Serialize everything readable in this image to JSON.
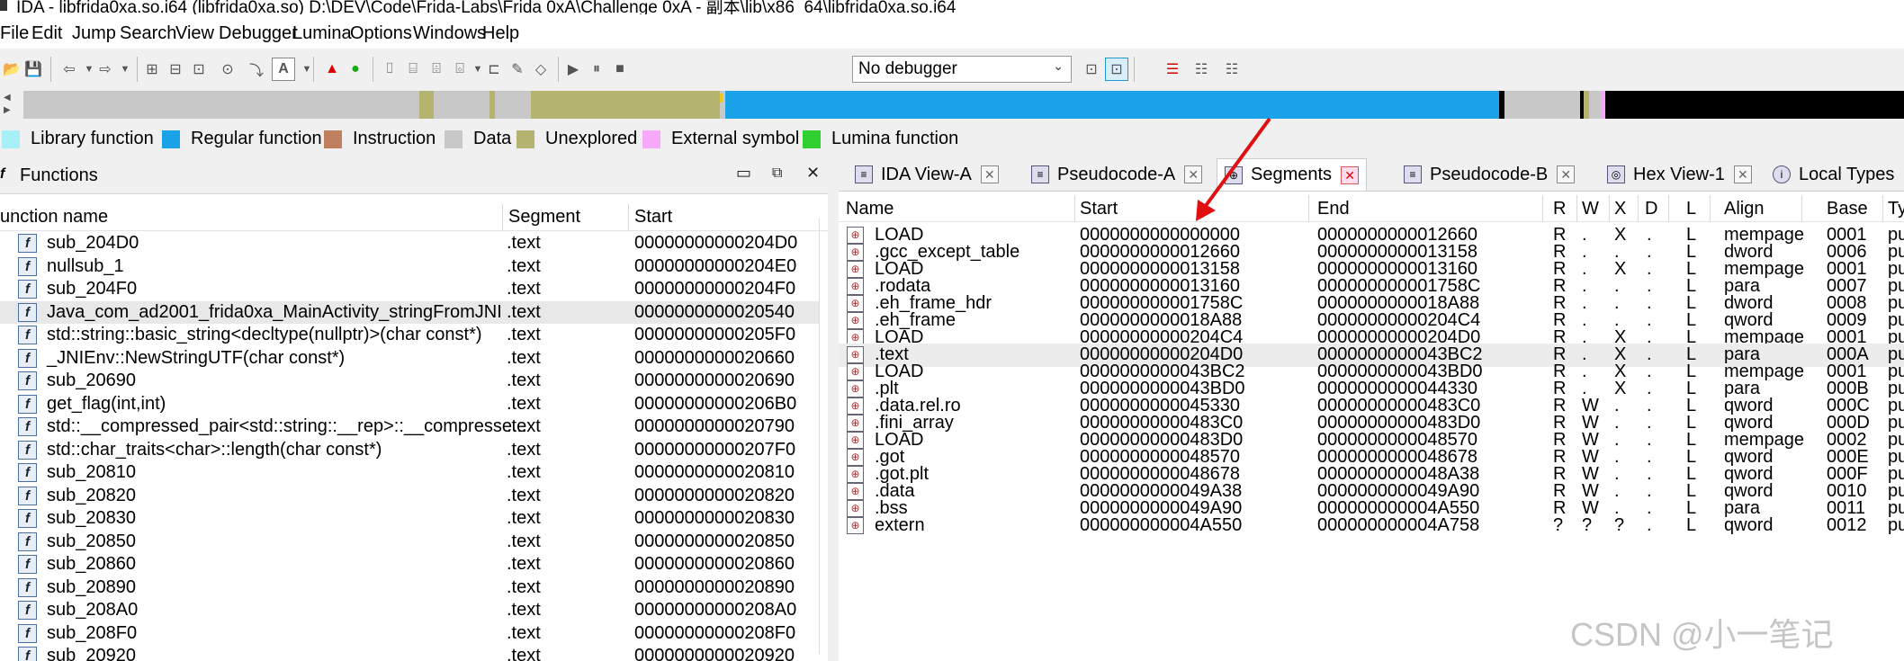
{
  "window": {
    "title": "IDA - libfrida0xa.so.i64 (libfrida0xa.so) D:\\DEV\\Code\\Frida-Labs\\Frida 0xA\\Challenge 0xA - 副本\\lib\\x86_64\\libfrida0xa.so.i64"
  },
  "menu": [
    "File",
    "Edit",
    "Jump",
    "Search",
    "View",
    "Debugger",
    "Lumina",
    "Options",
    "Windows",
    "Help"
  ],
  "toolbar": {
    "debugger_select": "No debugger"
  },
  "legend": [
    {
      "label": "Library function",
      "color": "#a8f0f8"
    },
    {
      "label": "Regular function",
      "color": "#1aa3e8"
    },
    {
      "label": "Instruction",
      "color": "#c08060"
    },
    {
      "label": "Data",
      "color": "#c8c8c8"
    },
    {
      "label": "Unexplored",
      "color": "#b4b470"
    },
    {
      "label": "External symbol",
      "color": "#f8a8f8"
    },
    {
      "label": "Lumina function",
      "color": "#30d030"
    }
  ],
  "functions": {
    "title": "Functions",
    "columns": [
      "unction name",
      "Segment",
      "Start"
    ],
    "rows": [
      {
        "name": "sub_204D0",
        "segment": ".text",
        "start": "00000000000204D0"
      },
      {
        "name": "nullsub_1",
        "segment": ".text",
        "start": "00000000000204E0"
      },
      {
        "name": "sub_204F0",
        "segment": ".text",
        "start": "00000000000204F0"
      },
      {
        "name": "Java_com_ad2001_frida0xa_MainActivity_stringFromJNI",
        "segment": ".text",
        "start": "0000000000020540"
      },
      {
        "name": "std::string::basic_string<decltype(nullptr)>(char const*)",
        "segment": ".text",
        "start": "00000000000205F0"
      },
      {
        "name": "_JNIEnv::NewStringUTF(char const*)",
        "segment": ".text",
        "start": "0000000000020660"
      },
      {
        "name": "sub_20690",
        "segment": ".text",
        "start": "0000000000020690"
      },
      {
        "name": "get_flag(int,int)",
        "segment": ".text",
        "start": "00000000000206B0"
      },
      {
        "name": "std::__compressed_pair<std::string::__rep>::__compresse...",
        "segment": ".text",
        "start": "0000000000020790"
      },
      {
        "name": "std::char_traits<char>::length(char const*)",
        "segment": ".text",
        "start": "00000000000207F0"
      },
      {
        "name": "sub_20810",
        "segment": ".text",
        "start": "0000000000020810"
      },
      {
        "name": "sub_20820",
        "segment": ".text",
        "start": "0000000000020820"
      },
      {
        "name": "sub_20830",
        "segment": ".text",
        "start": "0000000000020830"
      },
      {
        "name": "sub_20850",
        "segment": ".text",
        "start": "0000000000020850"
      },
      {
        "name": "sub_20860",
        "segment": ".text",
        "start": "0000000000020860"
      },
      {
        "name": "sub_20890",
        "segment": ".text",
        "start": "0000000000020890"
      },
      {
        "name": "sub_208A0",
        "segment": ".text",
        "start": "00000000000208A0"
      },
      {
        "name": "sub_208F0",
        "segment": ".text",
        "start": "00000000000208F0"
      },
      {
        "name": "sub_20920",
        "segment": ".text",
        "start": "0000000000020920"
      }
    ]
  },
  "tabs": [
    "IDA View-A",
    "Pseudocode-A",
    "Segments",
    "Pseudocode-B",
    "Hex View-1",
    "Local Types"
  ],
  "segments": {
    "columns": [
      "Name",
      "Start",
      "End",
      "R",
      "W",
      "X",
      "D",
      "L",
      "Align",
      "Base",
      "Ty"
    ],
    "rows": [
      {
        "name": "LOAD",
        "start": "0000000000000000",
        "end": "0000000000012660",
        "r": "R",
        "w": ".",
        "x": "X",
        "d": ".",
        "l": "L",
        "align": "mempage",
        "base": "0001",
        "type": "pu"
      },
      {
        "name": ".gcc_except_table",
        "start": "0000000000012660",
        "end": "0000000000013158",
        "r": "R",
        "w": ".",
        "x": ".",
        "d": ".",
        "l": "L",
        "align": "dword",
        "base": "0006",
        "type": "pu"
      },
      {
        "name": "LOAD",
        "start": "0000000000013158",
        "end": "0000000000013160",
        "r": "R",
        "w": ".",
        "x": "X",
        "d": ".",
        "l": "L",
        "align": "mempage",
        "base": "0001",
        "type": "pu"
      },
      {
        "name": ".rodata",
        "start": "0000000000013160",
        "end": "000000000001758C",
        "r": "R",
        "w": ".",
        "x": ".",
        "d": ".",
        "l": "L",
        "align": "para",
        "base": "0007",
        "type": "pu"
      },
      {
        "name": ".eh_frame_hdr",
        "start": "000000000001758C",
        "end": "0000000000018A88",
        "r": "R",
        "w": ".",
        "x": ".",
        "d": ".",
        "l": "L",
        "align": "dword",
        "base": "0008",
        "type": "pu"
      },
      {
        "name": ".eh_frame",
        "start": "0000000000018A88",
        "end": "00000000000204C4",
        "r": "R",
        "w": ".",
        "x": ".",
        "d": ".",
        "l": "L",
        "align": "qword",
        "base": "0009",
        "type": "pu"
      },
      {
        "name": "LOAD",
        "start": "00000000000204C4",
        "end": "00000000000204D0",
        "r": "R",
        "w": ".",
        "x": "X",
        "d": ".",
        "l": "L",
        "align": "mempage",
        "base": "0001",
        "type": "pu"
      },
      {
        "name": ".text",
        "start": "00000000000204D0",
        "end": "0000000000043BC2",
        "r": "R",
        "w": ".",
        "x": "X",
        "d": ".",
        "l": "L",
        "align": "para",
        "base": "000A",
        "type": "pu"
      },
      {
        "name": "LOAD",
        "start": "0000000000043BC2",
        "end": "0000000000043BD0",
        "r": "R",
        "w": ".",
        "x": "X",
        "d": ".",
        "l": "L",
        "align": "mempage",
        "base": "0001",
        "type": "pu"
      },
      {
        "name": ".plt",
        "start": "0000000000043BD0",
        "end": "0000000000044330",
        "r": "R",
        "w": ".",
        "x": "X",
        "d": ".",
        "l": "L",
        "align": "para",
        "base": "000B",
        "type": "pu"
      },
      {
        "name": ".data.rel.ro",
        "start": "0000000000045330",
        "end": "00000000000483C0",
        "r": "R",
        "w": "W",
        "x": ".",
        "d": ".",
        "l": "L",
        "align": "qword",
        "base": "000C",
        "type": "pu"
      },
      {
        "name": ".fini_array",
        "start": "00000000000483C0",
        "end": "00000000000483D0",
        "r": "R",
        "w": "W",
        "x": ".",
        "d": ".",
        "l": "L",
        "align": "qword",
        "base": "000D",
        "type": "pu"
      },
      {
        "name": "LOAD",
        "start": "00000000000483D0",
        "end": "0000000000048570",
        "r": "R",
        "w": "W",
        "x": ".",
        "d": ".",
        "l": "L",
        "align": "mempage",
        "base": "0002",
        "type": "pu"
      },
      {
        "name": ".got",
        "start": "0000000000048570",
        "end": "0000000000048678",
        "r": "R",
        "w": "W",
        "x": ".",
        "d": ".",
        "l": "L",
        "align": "qword",
        "base": "000E",
        "type": "pu"
      },
      {
        "name": ".got.plt",
        "start": "0000000000048678",
        "end": "0000000000048A38",
        "r": "R",
        "w": "W",
        "x": ".",
        "d": ".",
        "l": "L",
        "align": "qword",
        "base": "000F",
        "type": "pu"
      },
      {
        "name": ".data",
        "start": "0000000000049A38",
        "end": "0000000000049A90",
        "r": "R",
        "w": "W",
        "x": ".",
        "d": ".",
        "l": "L",
        "align": "qword",
        "base": "0010",
        "type": "pu"
      },
      {
        "name": ".bss",
        "start": "0000000000049A90",
        "end": "000000000004A550",
        "r": "R",
        "w": "W",
        "x": ".",
        "d": ".",
        "l": "L",
        "align": "para",
        "base": "0011",
        "type": "pu"
      },
      {
        "name": "extern",
        "start": "000000000004A550",
        "end": "000000000004A758",
        "r": "?",
        "w": "?",
        "x": "?",
        "d": ".",
        "l": "L",
        "align": "qword",
        "base": "0012",
        "type": "pu"
      }
    ]
  },
  "watermark": "CSDN @小一笔记"
}
